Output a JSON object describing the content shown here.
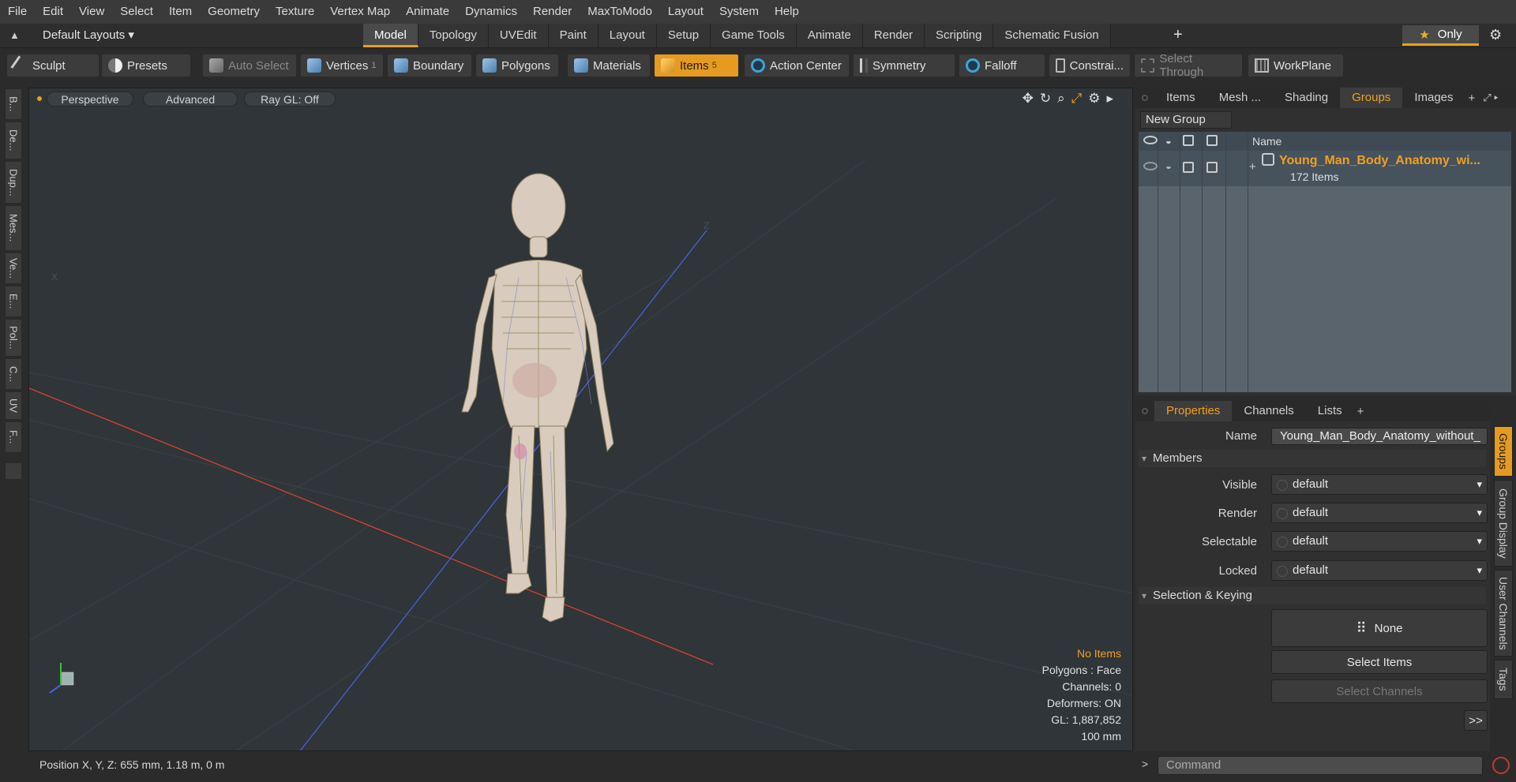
{
  "menubar": [
    "File",
    "Edit",
    "View",
    "Select",
    "Item",
    "Geometry",
    "Texture",
    "Vertex Map",
    "Animate",
    "Dynamics",
    "Render",
    "MaxToModo",
    "Layout",
    "System",
    "Help"
  ],
  "layoutbar": {
    "layout_select": "Default Layouts ▾",
    "tabs": [
      "Model",
      "Topology",
      "UVEdit",
      "Paint",
      "Layout",
      "Setup",
      "Game Tools",
      "Animate",
      "Render",
      "Scripting",
      "Schematic Fusion"
    ],
    "active_tab": "Model",
    "plus": "+",
    "only_label": "Only",
    "star": "★"
  },
  "toolbar": {
    "sculpt": "Sculpt",
    "presets": "Presets",
    "auto_select": "Auto Select",
    "vertices": "Vertices",
    "vertices_count": "1",
    "boundary": "Boundary",
    "polygons": "Polygons",
    "materials": "Materials",
    "items": "Items",
    "items_count": "5",
    "action_center": "Action Center",
    "symmetry": "Symmetry",
    "falloff": "Falloff",
    "constraints": "Constrai...",
    "select_through": "Select Through",
    "workplane": "WorkPlane"
  },
  "left_tabs": [
    "B...",
    "De...",
    "Dup...",
    "Mes...",
    "Ve...",
    "E...",
    "Pol...",
    "C...",
    "UV",
    "F..."
  ],
  "viewport": {
    "perspective": "Perspective",
    "advanced": "Advanced",
    "raygl": "Ray GL: Off",
    "info": {
      "no_items": "No Items",
      "polygons": "Polygons : Face",
      "channels": "Channels: 0",
      "deformers": "Deformers: ON",
      "gl": "GL: 1,887,852",
      "scale": "100 mm"
    },
    "axis_x": "X",
    "axis_z": "Z"
  },
  "status": {
    "position": "Position X, Y, Z:   655 mm, 1.18 m, 0 m"
  },
  "right_top": {
    "tabs": [
      "Items",
      "Mesh ...",
      "Shading",
      "Groups",
      "Images"
    ],
    "active_tab": "Groups",
    "new_group": "New Group",
    "col_name": "Name",
    "group_name": "Young_Man_Body_Anatomy_wi...",
    "group_count": "172 Items"
  },
  "properties": {
    "tabs": [
      "Properties",
      "Channels",
      "Lists"
    ],
    "active_tab": "Properties",
    "name_label": "Name",
    "name_value": "Young_Man_Body_Anatomy_without_",
    "members_section": "Members",
    "visible_label": "Visible",
    "visible_value": "default",
    "render_label": "Render",
    "render_value": "default",
    "selectable_label": "Selectable",
    "selectable_value": "default",
    "locked_label": "Locked",
    "locked_value": "default",
    "selkey_section": "Selection & Keying",
    "none_label": "None",
    "select_items": "Select Items",
    "select_channels": "Select Channels",
    "more": ">>"
  },
  "vertical_tabs": [
    "Groups",
    "Group Display",
    "User Channels",
    "Tags"
  ],
  "command": {
    "placeholder": "Command",
    "arrow": ">"
  },
  "colors": {
    "accent": "#e69a20",
    "selected_text": "#f0a020",
    "viewport_bg": "#2f3539",
    "axis_x": "#d8412f",
    "axis_z": "#4a5fd8"
  }
}
